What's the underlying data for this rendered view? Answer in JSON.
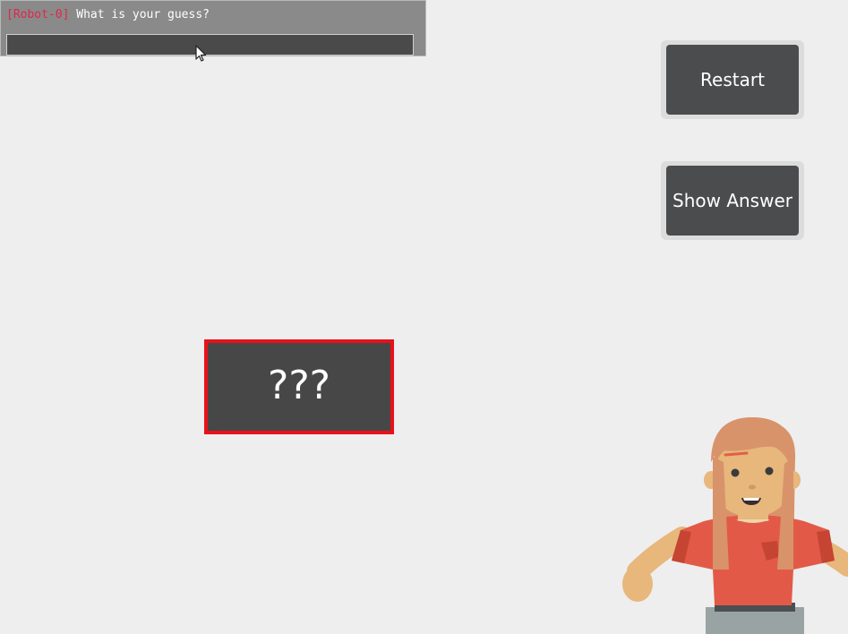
{
  "prompt": {
    "speaker": "[Robot-0]",
    "question": "What is your guess?",
    "input_value": ""
  },
  "buttons": {
    "restart": "Restart",
    "show_answer": "Show Answer"
  },
  "mystery_card": {
    "text": "???",
    "border_color": "#e8111a"
  },
  "colors": {
    "background": "#eeeeee",
    "button": "#4a4c4e",
    "card": "#474747",
    "speaker": "#e0284a"
  }
}
